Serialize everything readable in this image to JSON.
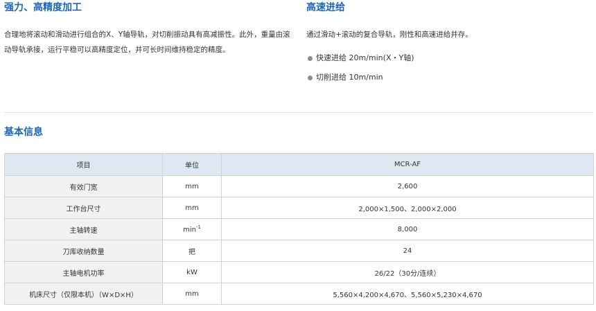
{
  "left": {
    "title": "强力、高精度加工",
    "description": "合理地将滚动和滑动进行组合的X、Y轴导轨，对切削振动具有高减振性。此外，重量由滚动导轨承接，运行平稳可以高精度定位，并可长时间维持稳定的精度。"
  },
  "right": {
    "title": "高速进给",
    "description": "通过滑动+滚动的复合导轨，刚性和高速进给并存。",
    "bullets": [
      "快速进给 20m/min(X・Y轴)",
      "切削进给 10m/min"
    ]
  },
  "basic_info": {
    "title": "基本信息",
    "headers": [
      "项目",
      "单位",
      "MCR-AF"
    ],
    "rows": [
      {
        "item": "有效门宽",
        "unit": "mm",
        "value": "2,600"
      },
      {
        "item": "工作台尺寸",
        "unit": "mm",
        "value": "2,000×1,500、2,000×2,000"
      },
      {
        "item": "主轴转速",
        "unit": "min",
        "unit_sup": "-1",
        "value": "8,000"
      },
      {
        "item": "刀库收纳数量",
        "unit": "把",
        "value": "24"
      },
      {
        "item": "主轴电机功率",
        "unit": "kW",
        "value": "26/22（30分/连续）"
      },
      {
        "item": "机床尺寸（仅限本机）（W×D×H）",
        "unit": "mm",
        "value": "5,560×4,200×4,670、5,560×5,230×4,670"
      }
    ]
  },
  "colors": {
    "accent": "#1a66b8",
    "header_bg": "#dde8f3",
    "name_bg": "#f1f1f1",
    "bullet": "#8a8f96"
  }
}
